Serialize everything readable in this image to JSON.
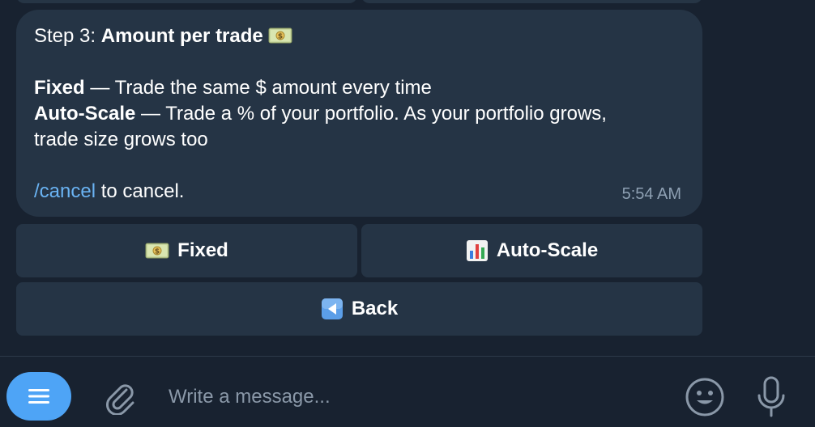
{
  "message": {
    "step_prefix": "Step 3: ",
    "step_title": "Amount per trade",
    "step_icon": "money-bills-icon",
    "fixed_label": "Fixed",
    "fixed_desc": " — Trade the same $ amount every time",
    "autoscale_label": "Auto-Scale",
    "autoscale_desc_line1": " — Trade a % of your portfolio. As your portfolio grows,",
    "autoscale_desc_line2": "trade size grows too",
    "cancel_command": "/cancel",
    "cancel_suffix": " to cancel.",
    "time": "5:54 AM"
  },
  "keyboard": {
    "fixed_button": {
      "icon": "money-bills-icon",
      "label": "Fixed"
    },
    "autoscale_button": {
      "icon": "bar-chart-icon",
      "label": "Auto-Scale"
    },
    "back_button": {
      "icon": "back-arrow-icon",
      "label": "Back"
    }
  },
  "composer": {
    "menu_icon": "hamburger-menu-icon",
    "attach_icon": "paperclip-icon",
    "placeholder": "Write a message...",
    "emoji_icon": "smiley-icon",
    "voice_icon": "microphone-icon"
  },
  "colors": {
    "background": "#182230",
    "bubble": "#253445",
    "link": "#6ab3f3",
    "accent": "#4ea4f6",
    "timestamp": "#8ea0b3"
  }
}
